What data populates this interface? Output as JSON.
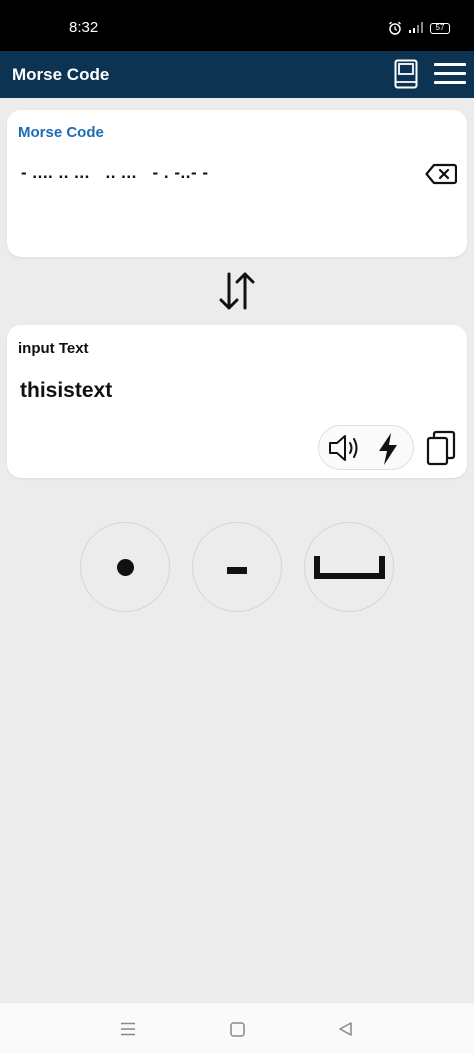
{
  "status_bar": {
    "time": "8:32",
    "battery": "57",
    "icons": [
      "alarm-icon",
      "signal-icon",
      "battery-icon"
    ]
  },
  "app_bar": {
    "title": "Morse Code",
    "icons": [
      "book-icon",
      "menu-icon"
    ],
    "color": "#0c3351"
  },
  "morse_panel": {
    "title": "Morse Code",
    "value": "- .... .. ...   .. ...   - . -..- -",
    "title_color": "#1e6db3",
    "clear_icon": "backspace-icon"
  },
  "swap": {
    "icon": "swap-vertical-icon"
  },
  "text_panel": {
    "title": "input Text",
    "value": "thisistext",
    "actions": [
      "speaker-icon",
      "flash-icon",
      "copy-icon"
    ]
  },
  "keys": [
    {
      "name": "dot",
      "icon": "dot-icon"
    },
    {
      "name": "dash",
      "icon": "dash-icon"
    },
    {
      "name": "space",
      "icon": "space-icon"
    }
  ],
  "nav_bar": {
    "icons": [
      "nav-menu-icon",
      "nav-home-icon",
      "nav-back-icon"
    ]
  }
}
